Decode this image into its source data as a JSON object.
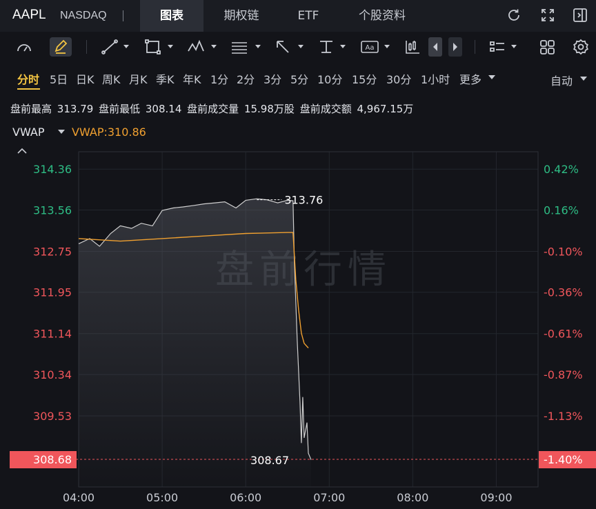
{
  "header": {
    "symbol": "AAPL",
    "exchange": "NASDAQ",
    "tabs": [
      {
        "label": "图表",
        "active": true
      },
      {
        "label": "期权链",
        "active": false
      },
      {
        "label": "ETF",
        "active": false
      },
      {
        "label": "个股资料",
        "active": false
      }
    ],
    "icons": [
      "refresh-icon",
      "fullscreen-icon",
      "collapse-panel-icon"
    ]
  },
  "toolbar": {
    "tools": [
      "speedometer-icon",
      "pencil-icon",
      "line-draw-icon",
      "rectangle-icon",
      "pattern-icon",
      "fibonacci-icon",
      "arrow-icon",
      "vertical-line-icon",
      "text-icon",
      "candlestick-icon",
      "prev-icon",
      "next-icon",
      "layout-icon",
      "grid-icon",
      "settings-icon"
    ]
  },
  "periods": {
    "items": [
      "分时",
      "5日",
      "日K",
      "周K",
      "月K",
      "季K",
      "年K",
      "1分",
      "2分",
      "3分",
      "5分",
      "10分",
      "15分",
      "30分",
      "1小时",
      "更多"
    ],
    "active": "分时",
    "auto_label": "自动"
  },
  "stats": {
    "high_label": "盘前最高",
    "high_value": "313.79",
    "low_label": "盘前最低",
    "low_value": "308.14",
    "volume_label": "盘前成交量",
    "volume_value": "15.98万股",
    "amount_label": "盘前成交额",
    "amount_value": "4,967.15万"
  },
  "indicator": {
    "name": "VWAP",
    "value_text": "VWAP:310.86"
  },
  "colors": {
    "up": "#2ebd85",
    "down": "#f0565b",
    "vwap": "#f0a030",
    "price_line": "#d0d0d0",
    "active_period": "#f4c542"
  },
  "chart_data": {
    "type": "line",
    "watermark": "盘前行情",
    "x_ticks": [
      "04:00",
      "05:00",
      "06:00",
      "07:00",
      "08:00",
      "09:00"
    ],
    "ylim": [
      308.14,
      314.7
    ],
    "y_ticks": [
      314.36,
      313.56,
      312.75,
      311.95,
      311.14,
      310.34,
      309.53
    ],
    "y_tick_labels": [
      "314.36",
      "313.56",
      "312.75",
      "311.95",
      "311.14",
      "310.34",
      "309.53"
    ],
    "pct_ticks": [
      "0.42%",
      "0.16%",
      "-0.10%",
      "-0.36%",
      "-0.61%",
      "-0.87%",
      "-1.13%"
    ],
    "current_price": "308.68",
    "current_pct": "-1.40%",
    "high_annotation": "313.76",
    "low_annotation": "308.67",
    "series": [
      {
        "name": "price",
        "x": [
          "04:00",
          "04:08",
          "04:15",
          "04:23",
          "04:30",
          "04:38",
          "04:45",
          "04:53",
          "05:00",
          "05:08",
          "05:15",
          "05:23",
          "05:30",
          "05:38",
          "05:45",
          "05:53",
          "06:00",
          "06:08",
          "06:15",
          "06:23",
          "06:30",
          "06:34",
          "06:35",
          "06:37",
          "06:39",
          "06:40",
          "06:41",
          "06:42",
          "06:44",
          "06:45",
          "06:47"
        ],
        "values": [
          312.9,
          313.0,
          312.85,
          313.1,
          313.25,
          313.2,
          313.3,
          313.25,
          313.55,
          313.6,
          313.62,
          313.65,
          313.68,
          313.7,
          313.72,
          313.6,
          313.75,
          313.78,
          313.76,
          313.7,
          313.75,
          313.74,
          312.5,
          311.0,
          309.8,
          309.0,
          309.9,
          309.1,
          309.4,
          308.8,
          308.67
        ]
      },
      {
        "name": "VWAP",
        "x": [
          "04:00",
          "04:30",
          "05:00",
          "05:30",
          "06:00",
          "06:30",
          "06:34",
          "06:36",
          "06:38",
          "06:40",
          "06:42",
          "06:45"
        ],
        "values": [
          313.0,
          312.95,
          313.0,
          313.05,
          313.1,
          313.12,
          313.12,
          312.2,
          311.6,
          311.15,
          310.95,
          310.86
        ]
      }
    ]
  }
}
